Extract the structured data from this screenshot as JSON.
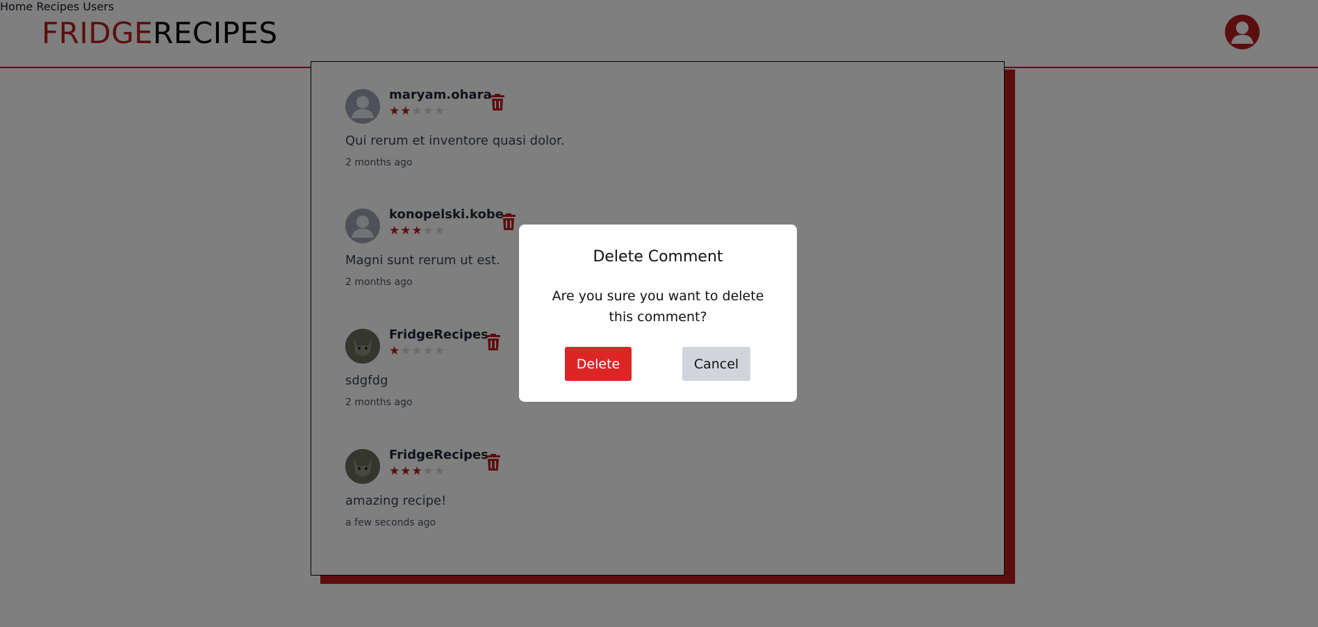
{
  "header": {
    "logo_part1": "FRIDGE",
    "logo_part2": "RECIPES",
    "nav": [
      "Home",
      "Recipes",
      "Users"
    ]
  },
  "comments": [
    {
      "user": "maryam.ohara",
      "rating": 2,
      "text": "Qui rerum et inventore quasi dolor.",
      "time": "2 months ago",
      "avatar": "default-avatar"
    },
    {
      "user": "konopelski.kobe",
      "rating": 3,
      "text": "Magni sunt rerum ut est.",
      "time": "2 months ago",
      "avatar": "default-avatar"
    },
    {
      "user": "FridgeRecipes",
      "rating": 1,
      "text": "sdgfdg",
      "time": "2 months ago",
      "avatar": "cat-photo"
    },
    {
      "user": "FridgeRecipes",
      "rating": 3,
      "text": "amazing recipe!",
      "time": "a few seconds ago",
      "avatar": "cat-photo"
    }
  ],
  "modal": {
    "title": "Delete Comment",
    "message": "Are you sure you want to delete this comment?",
    "delete_label": "Delete",
    "cancel_label": "Cancel"
  },
  "colors": {
    "brand": "#b91c1c",
    "delete_button": "#dc2626",
    "cancel_button": "#d1d5db"
  }
}
